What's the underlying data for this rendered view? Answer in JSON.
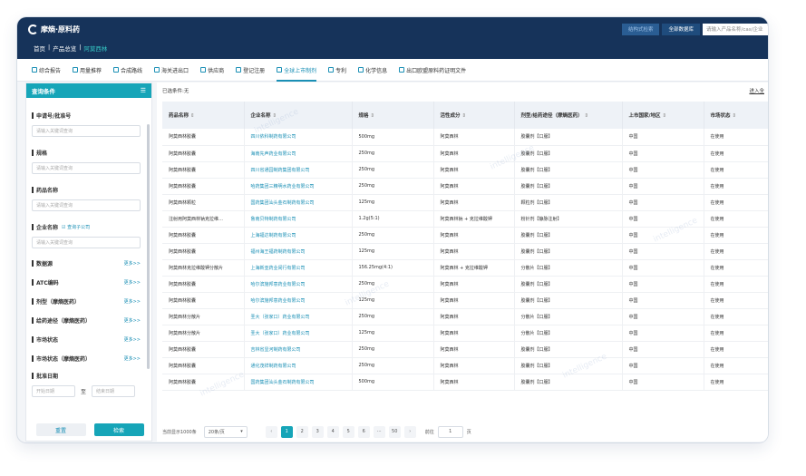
{
  "app": {
    "title": "摩熵·原料药"
  },
  "breadcrumb": {
    "home": "首页",
    "sep": "|",
    "section": "产品总览",
    "current": "阿莫西林"
  },
  "topbar": {
    "btn_structure": "结构式检索",
    "btn_all_db": "全部数据库",
    "search_placeholder": "请输入产品名称/cas/企业"
  },
  "tabs": [
    {
      "label": "综合报告"
    },
    {
      "label": "用量推荐"
    },
    {
      "label": "合成路线"
    },
    {
      "label": "海关进出口"
    },
    {
      "label": "供应商"
    },
    {
      "label": "登记注册"
    },
    {
      "label": "全球上市制剂"
    },
    {
      "label": "专利"
    },
    {
      "label": "化学信息"
    },
    {
      "label": "出口欧盟原料药证明文件"
    }
  ],
  "active_tab": "全球上市制剂",
  "sidebar": {
    "title": "查询条件",
    "fields": [
      {
        "label": "申请号/批准号",
        "placeholder": "请输入关键词查询"
      },
      {
        "label": "规格",
        "placeholder": "请输入关键词查询"
      },
      {
        "label": "药品名称",
        "placeholder": "请输入关键词查询"
      },
      {
        "label": "企业名称",
        "extra": "查询子公司",
        "placeholder": "请输入关键词查询"
      }
    ],
    "filters": [
      {
        "label": "数据源",
        "more": "更多>>"
      },
      {
        "label": "ATC编码",
        "more": "更多>>"
      },
      {
        "label": "剂型（摩熵医药）",
        "more": "更多>>"
      },
      {
        "label": "给药途径（摩熵医药）",
        "more": "更多>>"
      },
      {
        "label": "市场状态",
        "more": "更多>>"
      },
      {
        "label": "市场状态（摩熵医药）",
        "more": "更多>>"
      }
    ],
    "date": {
      "label": "批准日期",
      "start": "开始日期",
      "to": "至",
      "end": "结束日期"
    },
    "reset": "重置",
    "search": "检索"
  },
  "main": {
    "selected": "已选条件:无",
    "export": "进入全",
    "columns": [
      "药品名称",
      "企业名称",
      "规格",
      "活性成分",
      "剂型/给药途径（摩熵医药）",
      "上市国家/地区",
      "市场状态"
    ],
    "rows": [
      [
        "阿莫西林胶囊",
        "四川依科制药有限公司",
        "500mg",
        "阿莫西林",
        "胶囊剂【口服】",
        "中国",
        "在使用"
      ],
      [
        "阿莫西林胶囊",
        "海南先声药业有限公司",
        "250mg",
        "阿莫西林",
        "胶囊剂【口服】",
        "中国",
        "在使用"
      ],
      [
        "阿莫西林胶囊",
        "四川省通园制药集团有限公司",
        "250mg",
        "阿莫西林",
        "胶囊剂【口服】",
        "中国",
        "在使用"
      ],
      [
        "阿莫西林胶囊",
        "哈药集团三精明水药业有限公司",
        "250mg",
        "阿莫西林",
        "胶囊剂【口服】",
        "中国",
        "在使用"
      ],
      [
        "阿莫西林颗粒",
        "国药集团汕头金石制药有限公司",
        "125mg",
        "阿莫西林",
        "颗粒剂【口服】",
        "中国",
        "在使用"
      ],
      [
        "注射用阿莫西林钠克拉维…",
        "鲁南贝特制药有限公司",
        "1.2g(5:1)",
        "阿莫西林钠 + 克拉维酸钾",
        "粉针剂【静脉注射】",
        "中国",
        "在使用"
      ],
      [
        "阿莫西林胶囊",
        "上海福达制药有限公司",
        "250mg",
        "阿莫西林",
        "胶囊剂【口服】",
        "中国",
        "在使用"
      ],
      [
        "阿莫西林胶囊",
        "福州海王福药制药有限公司",
        "125mg",
        "阿莫西林",
        "胶囊剂【口服】",
        "中国",
        "在使用"
      ],
      [
        "阿莫西林克拉维酸钾分散片",
        "上海新亚药业闵行有限公司",
        "156.25mg(4:1)",
        "阿莫西林 + 克拉维酸钾",
        "分散片【口服】",
        "中国",
        "在使用"
      ],
      [
        "阿莫西林胶囊",
        "哈尔滨施邦意药业有限公司",
        "250mg",
        "阿莫西林",
        "胶囊剂【口服】",
        "中国",
        "在使用"
      ],
      [
        "阿莫西林胶囊",
        "哈尔滨施邦意药业有限公司",
        "125mg",
        "阿莫西林",
        "胶囊剂【口服】",
        "中国",
        "在使用"
      ],
      [
        "阿莫西林分散片",
        "圣大（张家口）药业有限公司",
        "250mg",
        "阿莫西林",
        "分散片【口服】",
        "中国",
        "在使用"
      ],
      [
        "阿莫西林分散片",
        "圣大（张家口）药业有限公司",
        "125mg",
        "阿莫西林",
        "分散片【口服】",
        "中国",
        "在使用"
      ],
      [
        "阿莫西林胶囊",
        "吉林省显河制药有限公司",
        "250mg",
        "阿莫西林",
        "胶囊剂【口服】",
        "中国",
        "在使用"
      ],
      [
        "阿莫西林胶囊",
        "通化茂祥制药有限公司",
        "250mg",
        "阿莫西林",
        "胶囊剂【口服】",
        "中国",
        "在使用"
      ],
      [
        "阿莫西林胶囊",
        "国药集团汕头金石制药有限公司",
        "500mg",
        "阿莫西林",
        "胶囊剂【口服】",
        "中国",
        "在使用"
      ]
    ]
  },
  "pager": {
    "total": "当前显示1000条",
    "page_size": "20条/页",
    "pages": [
      "1",
      "2",
      "3",
      "4",
      "5",
      "6",
      "···",
      "50"
    ],
    "active_page": "1",
    "goto_label": "前往",
    "goto_value": "1",
    "goto_unit": "页"
  },
  "watermark": "intelligence"
}
